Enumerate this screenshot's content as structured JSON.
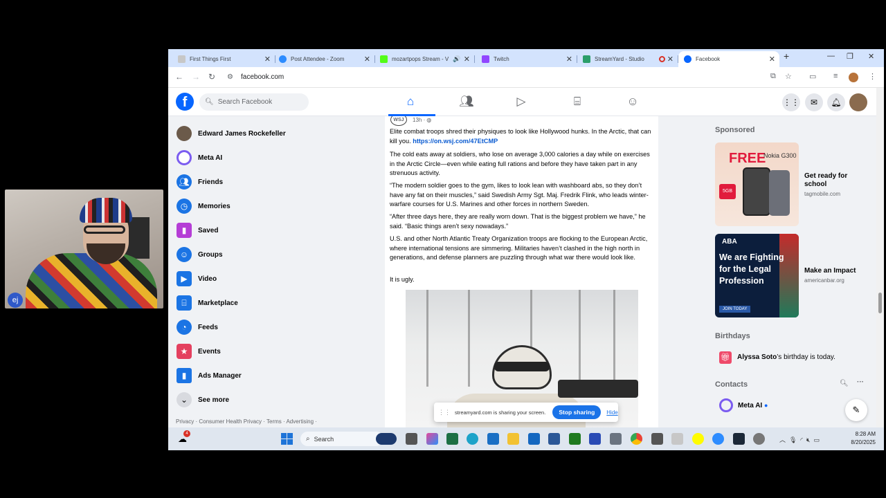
{
  "webcam": {
    "badge": "ej"
  },
  "browser": {
    "tabs": [
      {
        "label": "First Things First",
        "color": "#c7c7c7"
      },
      {
        "label": "Post Attendee - Zoom",
        "color": "#2d8cff"
      },
      {
        "label": "mozartpops Stream - V",
        "color": "#53fc18"
      },
      {
        "label": "Twitch",
        "color": "#9146ff"
      },
      {
        "label": "StreamYard - Studio",
        "color": "#2b9e6a"
      },
      {
        "label": "Facebook",
        "color": "#0866ff"
      }
    ],
    "url": "facebook.com"
  },
  "fb": {
    "logo": "f",
    "search_placeholder": "Search Facebook",
    "left_nav": [
      {
        "label": "Edward James Rockefeller",
        "icon": "profile-avatar"
      },
      {
        "label": "Meta AI",
        "icon": "meta-ai-icon"
      },
      {
        "label": "Friends",
        "icon": "friends-icon"
      },
      {
        "label": "Memories",
        "icon": "memories-icon"
      },
      {
        "label": "Saved",
        "icon": "saved-icon"
      },
      {
        "label": "Groups",
        "icon": "groups-icon"
      },
      {
        "label": "Video",
        "icon": "video-icon"
      },
      {
        "label": "Marketplace",
        "icon": "marketplace-icon"
      },
      {
        "label": "Feeds",
        "icon": "feeds-icon"
      },
      {
        "label": "Events",
        "icon": "events-icon"
      },
      {
        "label": "Ads Manager",
        "icon": "ads-manager-icon"
      },
      {
        "label": "See more",
        "icon": "chevron-down-icon"
      }
    ],
    "footer": "Privacy · Consumer Health Privacy · Terms · Advertising ·",
    "post": {
      "author_badge": "WSJ",
      "time": "13h · ",
      "paragraphs": [
        {
          "text": "Elite combat troops shred their physiques to look like Hollywood hunks. In the Arctic, that can kill you. ",
          "link": "https://on.wsj.com/47EtCMP"
        },
        {
          "text": "The cold eats away at soldiers, who lose on average 3,000 calories a day while on exercises in the Arctic Circle—even while eating full rations and before they have taken part in any strenuous activity."
        },
        {
          "text": "“The modern soldier goes to the gym, likes to look lean with washboard abs, so they don’t have any fat on their muscles,” said Swedish Army Sgt. Maj. Fredrik Flink, who leads winter-warfare courses for U.S. Marines and other forces in northern Sweden."
        },
        {
          "text": "“After three days here, they are really worn down. That is the biggest problem we have,” he said. “Basic things aren’t sexy nowadays.”"
        },
        {
          "text": "U.S. and other North Atlantic Treaty Organization troops are flocking to the European Arctic, where international tensions are simmering. Militaries haven’t clashed in the high north in generations, and defense planners are puzzling through what war there would look like."
        },
        {
          "text": "It is ugly."
        }
      ]
    },
    "right": {
      "sponsored": "Sponsored",
      "ads": [
        {
          "title": "Get ready for school",
          "url": "tagmobile.com",
          "img_text": "FREE",
          "img_sub": "Nokia G300",
          "img_badge": "5GB"
        },
        {
          "title": "Make an Impact",
          "url": "americanbar.org",
          "img_logo": "ABA",
          "img_text": "We are Fighting for the Legal Profession",
          "img_cta": "JOIN TODAY"
        }
      ],
      "birthdays_head": "Birthdays",
      "birthday_name": "Alyssa Soto",
      "birthday_suffix": "’s birthday is today.",
      "contacts_head": "Contacts",
      "contact_1": "Meta AI"
    }
  },
  "share": {
    "message": "streamyard.com is sharing your screen.",
    "stop": "Stop sharing",
    "hide": "Hide"
  },
  "taskbar": {
    "search": "Search",
    "notif_count": "4",
    "time": "8:28 AM",
    "date": "8/20/2025"
  }
}
